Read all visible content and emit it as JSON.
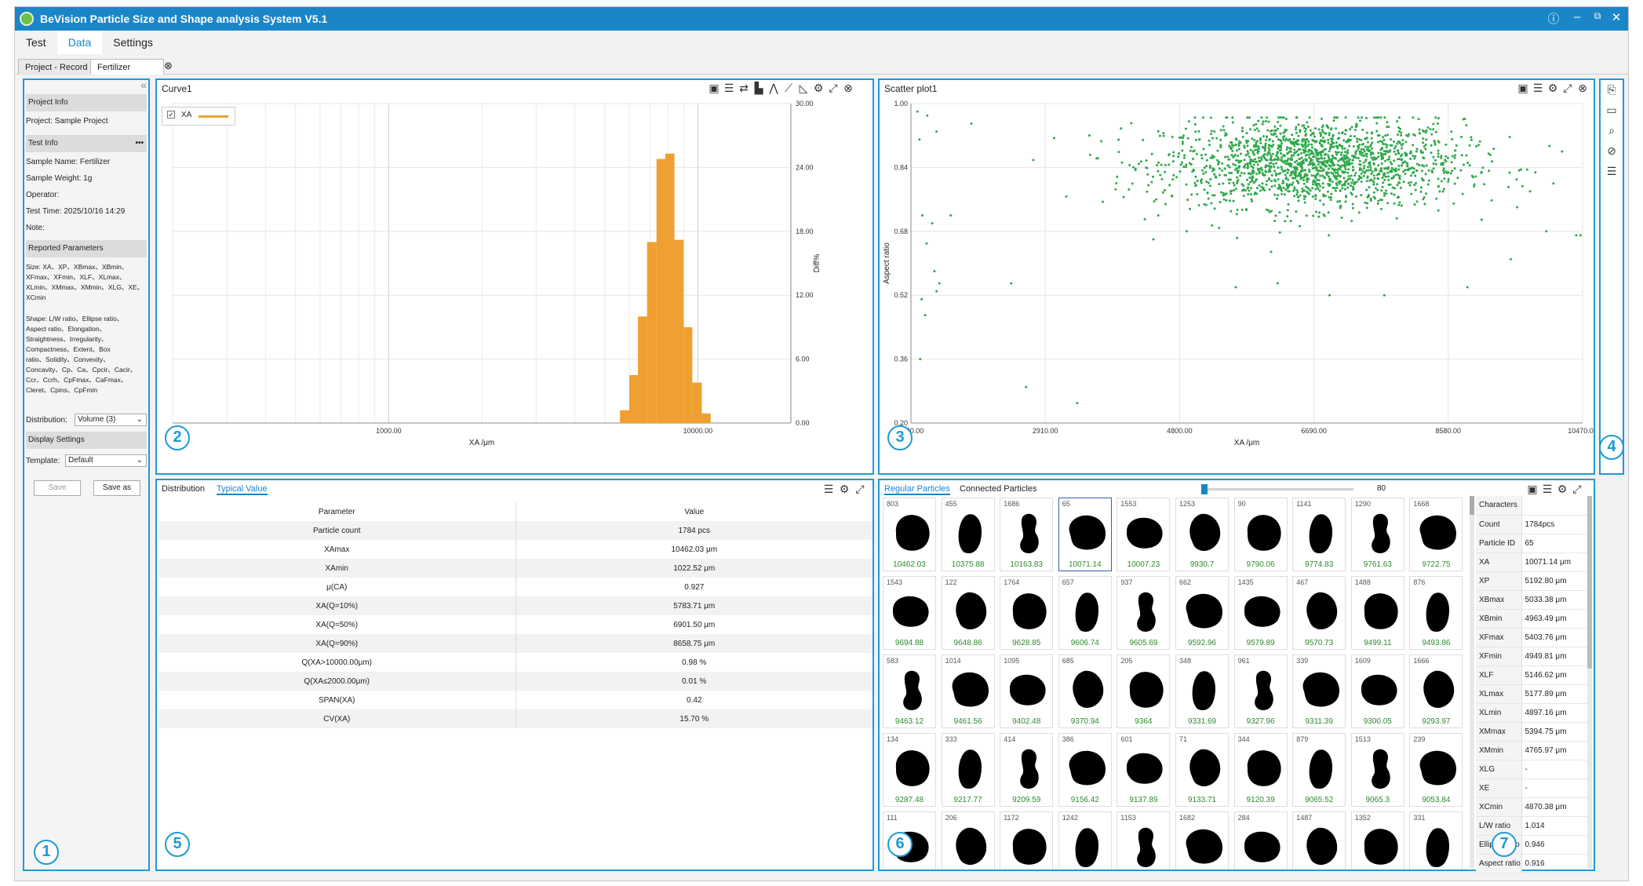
{
  "app": {
    "title": "BeVision Particle Size and Shape analysis System V5.1",
    "help_icon": "question-circle-icon",
    "minimize_icon": "minimize-icon",
    "restore_icon": "restore-icon",
    "close_icon": "close-icon"
  },
  "menu": [
    "Test",
    "Data",
    "Settings"
  ],
  "active_menu": "Data",
  "tabs": [
    "Project - Record",
    "Fertilizer"
  ],
  "active_tab": "Fertilizer",
  "tab_close": "⊗",
  "left_panel": {
    "project_info_header": "Project Info",
    "project": "Project: Sample Project",
    "test_info_header": "Test Info",
    "more": "•••",
    "sample_name": "Sample Name: Fertilizer",
    "sample_weight": "Sample Weight: 1g",
    "operator": "Operator:",
    "test_time": "Test Time: 2025/10/16 14:29",
    "note": "Note:",
    "reported_header": "Reported Parameters",
    "size_line1": "Size: XA、XP、XBmax、XBmin、",
    "size_line2": "XFmax、XFmin、XLF、XLmax、",
    "size_line3": "XLmin、XMmax、XMmin、XLG、XE、",
    "size_line4": "XCmin",
    "shape_line1": "Shape: L/W ratio、Ellipse ratio、",
    "shape_line2": "Aspect ratio、Elongation、",
    "shape_line3": "Straightness、Irregularity、",
    "shape_line4": "Compactness、Extent、Box",
    "shape_line5": "ratio、Solidity、Convexity、",
    "shape_line6": "Concavity、Cp、Ca、Cpcir、Cacir、",
    "shape_line7": "Ccr、Ccrh、CpFmax、CaFmax、",
    "shape_line8": "Cleret、Cpins、CpFmin",
    "distribution_label": "Distribution:",
    "distribution_value": "Volume (3)",
    "display_header": "Display Settings",
    "template_label": "Template:",
    "template_value": "Default",
    "save": "Save",
    "save_as": "Save as",
    "collapse": "«"
  },
  "curve_panel": {
    "title": "Curve1",
    "legend": "XA",
    "legend_color": "#f0a030",
    "xlabel": "XA /μm",
    "ylabel": "Diff%",
    "chart_data": {
      "type": "bar",
      "x_scale": "log",
      "xlim": [
        200,
        20000
      ],
      "ylim": [
        0,
        30
      ],
      "yticks": [
        "0.00",
        "6.00",
        "12.00",
        "18.00",
        "24.00",
        "30.00"
      ],
      "xticks": [
        "1000.00",
        "10000.00"
      ],
      "bins": [
        {
          "x0": 5600,
          "x1": 6000,
          "y": 1.2
        },
        {
          "x0": 6000,
          "x1": 6400,
          "y": 4.5
        },
        {
          "x0": 6400,
          "x1": 6850,
          "y": 10.0
        },
        {
          "x0": 6850,
          "x1": 7350,
          "y": 17.0
        },
        {
          "x0": 7350,
          "x1": 7850,
          "y": 24.8
        },
        {
          "x0": 7850,
          "x1": 8400,
          "y": 25.3
        },
        {
          "x0": 8400,
          "x1": 9000,
          "y": 17.2
        },
        {
          "x0": 9000,
          "x1": 9600,
          "y": 9.0
        },
        {
          "x0": 9600,
          "x1": 10300,
          "y": 3.8
        },
        {
          "x0": 10300,
          "x1": 11000,
          "y": 0.9
        }
      ]
    }
  },
  "scatter_panel": {
    "title": "Scatter plot1",
    "xlabel": "XA /μm",
    "ylabel": "Aspect ratio",
    "color": "#2ea84a",
    "chart_data": {
      "type": "scatter",
      "xlim": [
        1020,
        10470
      ],
      "ylim": [
        0.2,
        1.0
      ],
      "xticks": [
        "1020.00",
        "2910.00",
        "4800.00",
        "6690.00",
        "8580.00",
        "10470.00"
      ],
      "yticks": [
        "0.20",
        "0.36",
        "0.52",
        "0.68",
        "0.84",
        "1.00"
      ],
      "cluster": {
        "x_center": 6690,
        "x_sd": 1050,
        "y_center": 0.85,
        "y_sd": 0.055,
        "count": 1784
      },
      "outliers": [
        [
          1110,
          0.98
        ],
        [
          1140,
          0.91
        ],
        [
          1250,
          0.97
        ],
        [
          1380,
          0.93
        ],
        [
          1870,
          0.95
        ],
        [
          1180,
          0.72
        ],
        [
          1320,
          0.7
        ],
        [
          1580,
          0.72
        ],
        [
          1240,
          0.65
        ],
        [
          1350,
          0.58
        ],
        [
          1420,
          0.55
        ],
        [
          1380,
          0.53
        ],
        [
          1170,
          0.51
        ],
        [
          1220,
          0.47
        ],
        [
          1150,
          0.36
        ],
        [
          2430,
          0.55
        ],
        [
          2640,
          0.29
        ],
        [
          3360,
          0.25
        ],
        [
          4470,
          0.76
        ],
        [
          4500,
          0.72
        ],
        [
          4430,
          0.66
        ],
        [
          4900,
          0.68
        ],
        [
          5590,
          0.54
        ],
        [
          6180,
          0.55
        ],
        [
          6910,
          0.52
        ],
        [
          6900,
          0.67
        ],
        [
          7680,
          0.52
        ],
        [
          8850,
          0.54
        ],
        [
          9460,
          0.61
        ],
        [
          9960,
          0.68
        ],
        [
          10440,
          0.67
        ],
        [
          10380,
          0.67
        ],
        [
          9730,
          0.78
        ],
        [
          10060,
          0.8
        ],
        [
          10180,
          0.88
        ]
      ]
    }
  },
  "typical_panel": {
    "tabs": [
      "Distribution",
      "Typical Value"
    ],
    "active_tab": "Typical Value",
    "header": [
      "Parameter",
      "Value"
    ],
    "rows": [
      [
        "Particle count",
        "1784 pcs"
      ],
      [
        "XAmax",
        "10462.03 μm"
      ],
      [
        "XAmin",
        "1022.52 μm"
      ],
      [
        "μ(CA)",
        "0.927"
      ],
      [
        "XA(Q=10%)",
        "5783.71 μm"
      ],
      [
        "XA(Q=50%)",
        "6901.50 μm"
      ],
      [
        "XA(Q=90%)",
        "8658.75 μm"
      ],
      [
        "Q(XA>10000.00μm)",
        "0.98 %"
      ],
      [
        "Q(XA≤2000.00μm)",
        "0.01 %"
      ],
      [
        "SPAN(XA)",
        "0.42"
      ],
      [
        "CV(XA)",
        "15.70 %"
      ]
    ]
  },
  "particles_panel": {
    "tabs": [
      "Regular Particles",
      "Connected Particles"
    ],
    "active_tab": "Regular Particles",
    "slider_value": "80",
    "slider_fraction": 0.0,
    "particles": [
      {
        "id": "803",
        "v": "10462.03"
      },
      {
        "id": "455",
        "v": "10375.88"
      },
      {
        "id": "1686",
        "v": "10163.83"
      },
      {
        "id": "65",
        "v": "10071.14"
      },
      {
        "id": "1553",
        "v": "10007.23"
      },
      {
        "id": "1253",
        "v": "9930.7"
      },
      {
        "id": "90",
        "v": "9790.06"
      },
      {
        "id": "1141",
        "v": "9774.83"
      },
      {
        "id": "1290",
        "v": "9761.63"
      },
      {
        "id": "1668",
        "v": "9722.75"
      },
      {
        "id": "1543",
        "v": "9694.88"
      },
      {
        "id": "122",
        "v": "9648.86"
      },
      {
        "id": "1764",
        "v": "9628.85"
      },
      {
        "id": "657",
        "v": "9606.74"
      },
      {
        "id": "937",
        "v": "9605.69"
      },
      {
        "id": "662",
        "v": "9592.96"
      },
      {
        "id": "1435",
        "v": "9579.89"
      },
      {
        "id": "467",
        "v": "9570.73"
      },
      {
        "id": "1488",
        "v": "9499.11"
      },
      {
        "id": "876",
        "v": "9493.86"
      },
      {
        "id": "583",
        "v": "9463.12"
      },
      {
        "id": "1014",
        "v": "9461.56"
      },
      {
        "id": "1095",
        "v": "9402.48"
      },
      {
        "id": "685",
        "v": "9370.94"
      },
      {
        "id": "205",
        "v": "9364"
      },
      {
        "id": "348",
        "v": "9331.69"
      },
      {
        "id": "961",
        "v": "9327.96"
      },
      {
        "id": "339",
        "v": "9311.39"
      },
      {
        "id": "1609",
        "v": "9300.05"
      },
      {
        "id": "1666",
        "v": "9293.97"
      },
      {
        "id": "134",
        "v": "9287.48"
      },
      {
        "id": "333",
        "v": "9217.77"
      },
      {
        "id": "414",
        "v": "9209.59"
      },
      {
        "id": "386",
        "v": "9156.42"
      },
      {
        "id": "601",
        "v": "9137.89"
      },
      {
        "id": "71",
        "v": "9133.71"
      },
      {
        "id": "344",
        "v": "9120.39"
      },
      {
        "id": "879",
        "v": "9065.52"
      },
      {
        "id": "1513",
        "v": "9065.3"
      },
      {
        "id": "239",
        "v": "9053.84"
      },
      {
        "id": "111",
        "v": ""
      },
      {
        "id": "206",
        "v": ""
      },
      {
        "id": "1172",
        "v": ""
      },
      {
        "id": "1242",
        "v": ""
      },
      {
        "id": "1153",
        "v": ""
      },
      {
        "id": "1682",
        "v": ""
      },
      {
        "id": "284",
        "v": ""
      },
      {
        "id": "1487",
        "v": ""
      },
      {
        "id": "1352",
        "v": ""
      },
      {
        "id": "331",
        "v": ""
      }
    ],
    "selected_id": "65",
    "characters": [
      [
        "Characters",
        ""
      ],
      [
        "Count",
        "1784pcs"
      ],
      [
        "Particle ID",
        "65"
      ],
      [
        "XA",
        "10071.14 μm"
      ],
      [
        "XP",
        "5192.80 μm"
      ],
      [
        "XBmax",
        "5033.38 μm"
      ],
      [
        "XBmin",
        "4963.49 μm"
      ],
      [
        "XFmax",
        "5403.76 μm"
      ],
      [
        "XFmin",
        "4949.81 μm"
      ],
      [
        "XLF",
        "5146.62 μm"
      ],
      [
        "XLmax",
        "5177.89 μm"
      ],
      [
        "XLmin",
        "4897.16 μm"
      ],
      [
        "XMmax",
        "5394.75 μm"
      ],
      [
        "XMmin",
        "4765.97 μm"
      ],
      [
        "XLG",
        "-"
      ],
      [
        "XE",
        "-"
      ],
      [
        "XCmin",
        "4870.38 μm"
      ],
      [
        "L/W ratio",
        "1.014"
      ],
      [
        "Ellipse ratio",
        "0.946"
      ],
      [
        "Aspect ratio",
        "0.916"
      ]
    ]
  },
  "badges": [
    "1",
    "2",
    "3",
    "4",
    "5",
    "6",
    "7"
  ],
  "right_toolbar_icons": [
    "export-icon",
    "open-folder-icon",
    "search-doc-icon",
    "no-entry-icon",
    "report-icon"
  ]
}
